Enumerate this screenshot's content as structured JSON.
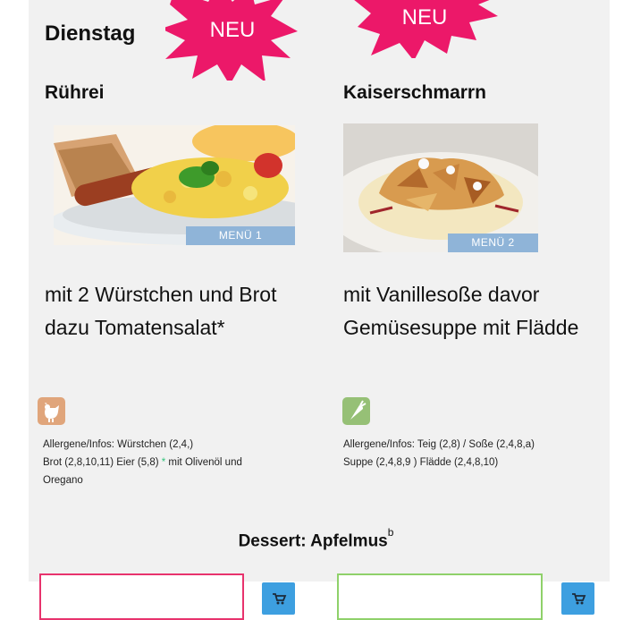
{
  "day": "Dienstag",
  "badges": [
    "NEU",
    "NEU"
  ],
  "menus": [
    {
      "title": "Rührei",
      "tag": "MENÜ 1",
      "description_line1": "mit 2 Würstchen und Brot",
      "description_line2": "dazu Tomatensalat*",
      "diet_icon": "chicken-icon",
      "allergen_line1": "Allergene/Infos: Würstchen (2,4,)",
      "allergen_line2": "Brot (2,8,10,11) Eier (5,8) ",
      "allergen_star": "*",
      "allergen_line2b": " mit Olivenöl und",
      "allergen_line3": "Oregano",
      "quantity_value": ""
    },
    {
      "title": "Kaiserschmarrn",
      "tag": "MENÜ 2",
      "description_line1": "mit Vanillesoße davor",
      "description_line2": "Gemüsesuppe mit Flädde",
      "diet_icon": "carrot-icon",
      "allergen_line1": "Allergene/Infos: Teig (2,8) / Soße (2,4,8,a)",
      "allergen_line2": "Suppe (2,4,8,9 ) Flädde (2,4,8,10)",
      "quantity_value": ""
    }
  ],
  "dessert": {
    "label": "Dessert: Apfelmus",
    "superscript": "b"
  },
  "colors": {
    "badge": "#ec1869",
    "qty_border_1": "#e8336d",
    "qty_border_2": "#8fd16a",
    "cart": "#3d9fe0",
    "menu_tag": "#8fb4d8"
  }
}
